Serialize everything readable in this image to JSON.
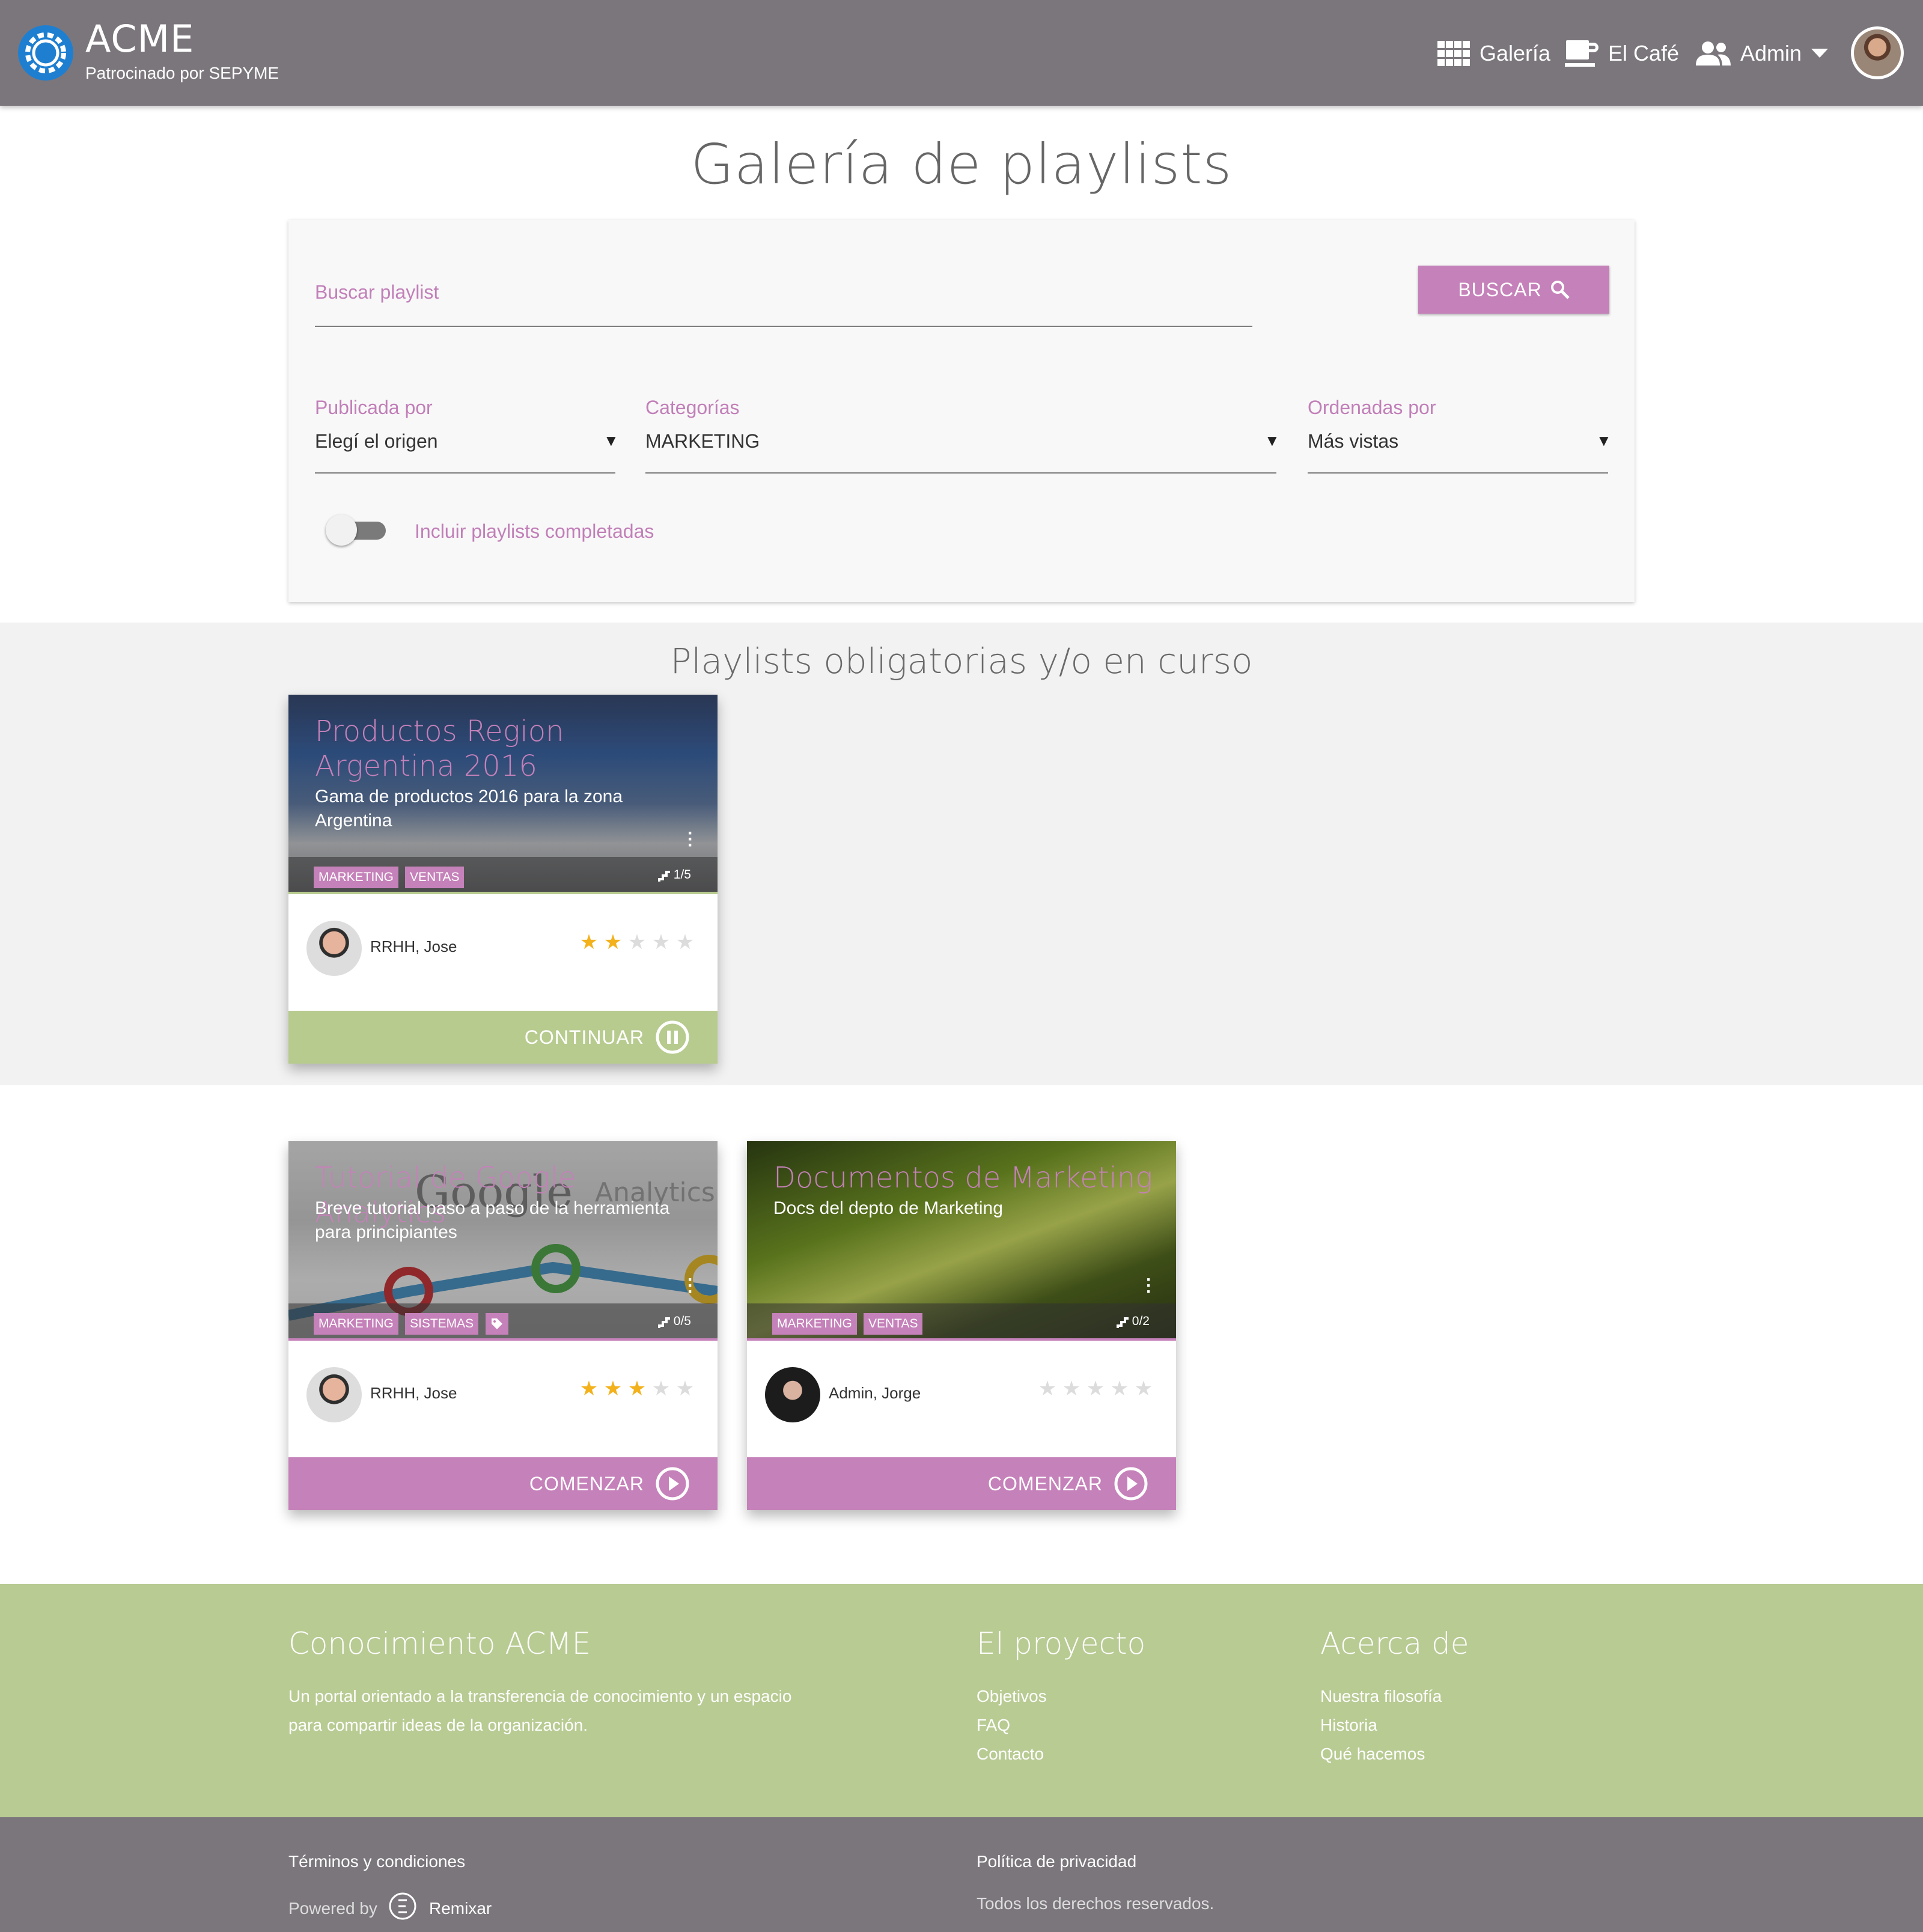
{
  "header": {
    "brand_name": "ACME",
    "brand_sub": "Patrocinado por SEPYME",
    "nav": [
      {
        "label": "Galería",
        "icon": "grid-icon"
      },
      {
        "label": "El Café",
        "icon": "coffee-icon"
      },
      {
        "label": "Admin",
        "icon": "people-icon"
      }
    ]
  },
  "page_title": "Galería de playlists",
  "search": {
    "placeholder": "Buscar playlist",
    "button_label": "BUSCAR",
    "filters": [
      {
        "label": "Publicada por",
        "value": "Elegí el origen"
      },
      {
        "label": "Categorías",
        "value": "MARKETING"
      },
      {
        "label": "Ordenadas por",
        "value": "Más vistas"
      }
    ],
    "toggle_label": "Incluir playlists completadas",
    "toggle_on": false
  },
  "section_in_progress": {
    "title": "Playlists obligatorias y/o en curso"
  },
  "cards": [
    {
      "title": "Productos Region Argentina 2016",
      "description": "Gama de productos 2016 para la zona Argentina",
      "tags": [
        "MARKETING",
        "VENTAS"
      ],
      "progress": "1/5",
      "author": "RRHH, Jose",
      "rating": 2,
      "rating_max": 5,
      "action_label": "CONTINUAR",
      "action_icon": "pause-circle-icon"
    },
    {
      "title": "Tutorial de Google Analytics",
      "description": "Breve tutorial paso a paso de la herramienta para principiantes",
      "tags": [
        "MARKETING",
        "SISTEMAS"
      ],
      "extra_tag_icon": "tag-icon",
      "progress": "0/5",
      "author": "RRHH, Jose",
      "rating": 3,
      "rating_max": 5,
      "action_label": "COMENZAR",
      "action_icon": "play-circle-icon"
    },
    {
      "title": "Documentos de Marketing",
      "description": "Docs del depto de Marketing",
      "tags": [
        "MARKETING",
        "VENTAS"
      ],
      "progress": "0/2",
      "author": "Admin, Jorge",
      "rating": 0,
      "rating_max": 5,
      "action_label": "COMENZAR",
      "action_icon": "play-circle-icon"
    }
  ],
  "footer": {
    "about_title": "Conocimiento ACME",
    "about_text_line1": "Un portal orientado a la transferencia de conocimiento y un espacio",
    "about_text_line2": "para compartir ideas de la organización.",
    "project_title": "El proyecto",
    "project_links": [
      "Objetivos",
      "FAQ",
      "Contacto"
    ],
    "acerca_title": "Acerca de",
    "acerca_links": [
      "Nuestra filosofía",
      "Historia",
      "Qué hacemos"
    ],
    "terms": "Términos y condiciones",
    "privacy": "Política de privacidad",
    "powered_by": "Powered by",
    "powered_brand": "Remixar",
    "rights": "Todos los derechos reservados."
  },
  "colors": {
    "header_bg": "#7b767c",
    "accent_pink": "#c581b9",
    "accent_green": "#b7cb8f",
    "star_on": "#f3b21c"
  }
}
